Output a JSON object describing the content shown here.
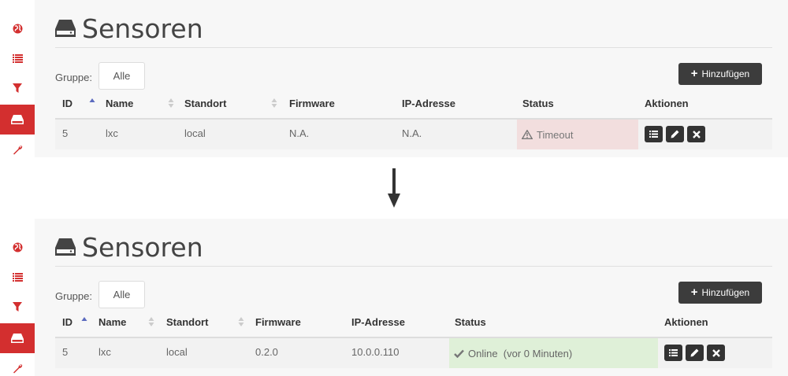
{
  "page": {
    "title": "Sensoren",
    "add_button": "Hinzufügen",
    "group_label": "Gruppe:",
    "group_value": "Alle",
    "columns": [
      "ID",
      "Name",
      "Standort",
      "Firmware",
      "IP-Adresse",
      "Status",
      "Aktionen"
    ]
  },
  "before": {
    "row": {
      "id": "5",
      "name": "lxc",
      "location": "local",
      "firmware": "N.A.",
      "ip": "N.A.",
      "status": "Timeout"
    }
  },
  "after": {
    "row": {
      "id": "5",
      "name": "lxc",
      "location": "local",
      "firmware": "0.2.0",
      "ip": "10.0.0.110",
      "status": "Online  (vor 0 Minuten)"
    }
  },
  "colors": {
    "accent": "#d32f2f",
    "timeout_bg": "#f2dede",
    "online_bg": "#dff0d8",
    "button_dark": "#3c3c3c"
  },
  "icons": [
    "globe-icon",
    "list-icon",
    "filter-icon",
    "drive-icon",
    "wrench-icon",
    "plus-icon",
    "warning-icon",
    "check-icon",
    "details-icon",
    "edit-icon",
    "delete-icon",
    "arrow-down-icon"
  ]
}
